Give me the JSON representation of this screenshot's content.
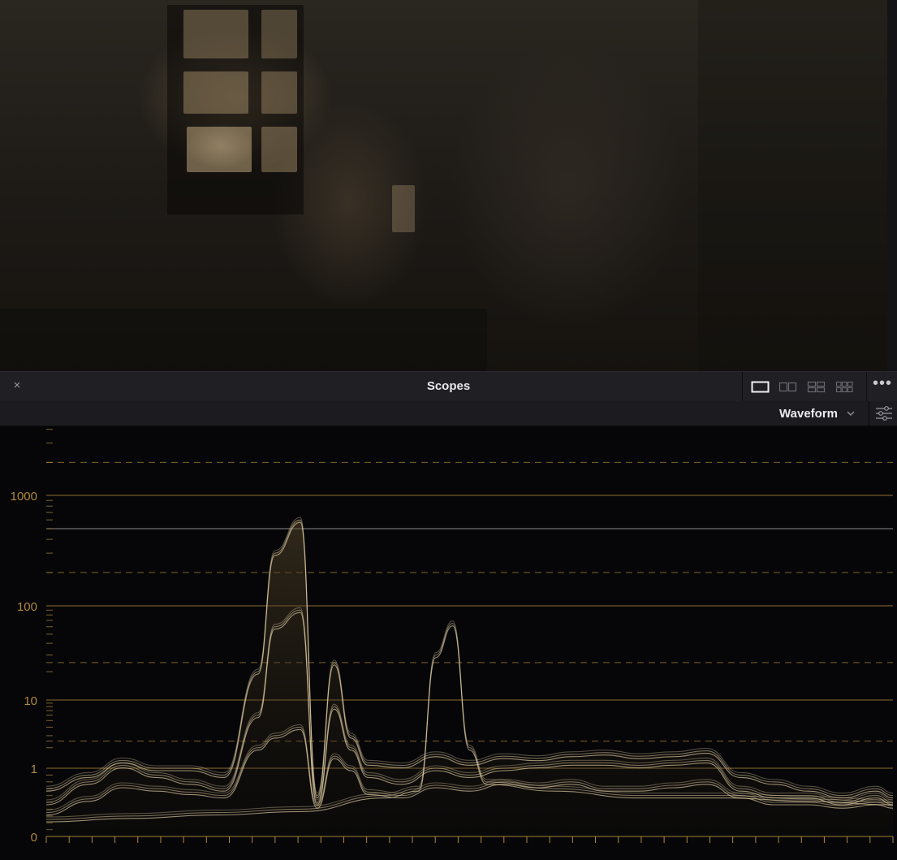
{
  "panel": {
    "title": "Scopes",
    "close_icon": "×",
    "more_icon": "•••"
  },
  "layout_buttons": [
    {
      "name": "single-view-layout-icon",
      "active": true
    },
    {
      "name": "two-up-layout-icon",
      "active": false
    },
    {
      "name": "four-up-layout-icon",
      "active": false
    },
    {
      "name": "six-up-layout-icon",
      "active": false
    }
  ],
  "toolbar": {
    "scope_type": "Waveform",
    "settings_icon": "sliders-icon"
  },
  "colors": {
    "accent_gold": "#b08a3c",
    "trace": "#e8d4a8",
    "panel_bg": "#1f1f24"
  },
  "chart_data": {
    "type": "line",
    "scale": "log",
    "y_tick_labels": [
      "0",
      "1",
      "10",
      "100",
      "1000"
    ],
    "y_major": [
      1,
      10,
      100,
      1000
    ],
    "y_solid_white": [
      500
    ],
    "y_dashed": [
      2.5,
      25,
      200,
      2000
    ],
    "ylim": [
      0,
      4000
    ],
    "xlim": [
      0,
      100
    ],
    "series": [
      {
        "x": [
          0,
          5,
          9,
          13,
          17,
          21,
          25,
          27,
          30,
          32,
          34,
          36,
          38,
          42,
          46,
          50,
          54,
          58,
          62,
          66,
          70,
          74,
          78,
          82,
          86,
          90,
          94,
          98,
          100
        ],
        "y": [
          0.7,
          0.9,
          1.3,
          1.0,
          1.0,
          0.9,
          20,
          300,
          600,
          0.6,
          25,
          3,
          1.2,
          1.1,
          1.6,
          1.2,
          1.5,
          1.4,
          1.6,
          1.7,
          1.5,
          1.6,
          1.8,
          0.9,
          0.8,
          0.7,
          0.6,
          0.7,
          0.6
        ]
      },
      {
        "x": [
          0,
          5,
          9,
          13,
          17,
          21,
          25,
          27,
          30,
          32,
          34,
          36,
          38,
          42,
          46,
          50,
          54,
          58,
          62,
          66,
          70,
          74,
          78,
          82,
          86,
          90,
          94,
          98,
          100
        ],
        "y": [
          0.5,
          0.8,
          1.1,
          0.9,
          0.8,
          0.7,
          6,
          60,
          90,
          0.5,
          8,
          2,
          0.9,
          0.8,
          1.0,
          0.9,
          1.0,
          1.1,
          1.2,
          1.2,
          1.1,
          1.2,
          1.3,
          0.7,
          0.6,
          0.6,
          0.5,
          0.6,
          0.5
        ]
      },
      {
        "x": [
          0,
          5,
          9,
          13,
          17,
          21,
          25,
          27,
          30,
          32,
          34,
          36,
          38,
          42,
          46,
          50,
          54,
          58,
          62,
          66,
          70,
          74,
          78,
          82,
          86,
          90,
          94,
          98,
          100
        ],
        "y": [
          0.35,
          0.55,
          0.75,
          0.7,
          0.65,
          0.6,
          2,
          3,
          4,
          0.45,
          1.5,
          1.0,
          0.65,
          0.6,
          0.75,
          0.7,
          0.8,
          0.75,
          0.8,
          0.7,
          0.7,
          0.75,
          0.8,
          0.6,
          0.5,
          0.5,
          0.45,
          0.5,
          0.45
        ]
      },
      {
        "x": [
          0,
          10,
          20,
          30,
          40,
          44,
          46,
          48,
          50,
          52,
          60,
          70,
          80,
          90,
          100
        ],
        "y": [
          0.25,
          0.3,
          0.35,
          0.4,
          0.6,
          0.7,
          30,
          65,
          2,
          0.8,
          0.7,
          0.6,
          0.6,
          0.55,
          0.5
        ]
      }
    ]
  }
}
